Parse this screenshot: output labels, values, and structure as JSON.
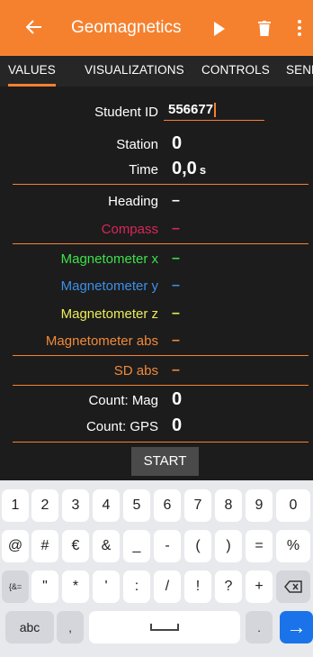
{
  "appbar": {
    "title": "Geomagnetics",
    "icons": [
      "back-arrow-icon",
      "play-icon",
      "trash-icon",
      "more-vert-icon"
    ],
    "color": "#f5812f"
  },
  "tabs": [
    "VALUES",
    "VISUALIZATIONS",
    "CONTROLS",
    "SEND"
  ],
  "active_tab": "VALUES",
  "fields": {
    "student_id": {
      "label": "Student ID",
      "value": "556677"
    },
    "station": {
      "label": "Station",
      "value": "0"
    },
    "time": {
      "label": "Time",
      "value": "0,0",
      "unit": "s"
    },
    "heading": {
      "label": "Heading",
      "value": "–"
    },
    "compass": {
      "label": "Compass",
      "value": "–",
      "color": "#d8265b"
    },
    "mag_x": {
      "label": "Magnetometer x",
      "value": "–",
      "color": "#3de14a"
    },
    "mag_y": {
      "label": "Magnetometer y",
      "value": "–",
      "color": "#3d8fe8"
    },
    "mag_z": {
      "label": "Magnetometer z",
      "value": "–",
      "color": "#ecec5a"
    },
    "mag_abs": {
      "label": "Magnetometer abs",
      "value": "–",
      "color": "#f08a3a"
    },
    "sd_abs": {
      "label": "SD abs",
      "value": "–",
      "color": "#f08a3a"
    },
    "count_mag": {
      "label": "Count: Mag",
      "value": "0"
    },
    "count_gps": {
      "label": "Count: GPS",
      "value": "0"
    }
  },
  "start_button": "START",
  "keyboard": {
    "row1": [
      "1",
      "2",
      "3",
      "4",
      "5",
      "6",
      "7",
      "8",
      "9",
      "0"
    ],
    "row2": [
      "@",
      "#",
      "€",
      "&",
      "_",
      "-",
      "(",
      ")",
      "=",
      "%"
    ],
    "row3": [
      "{&=",
      "\"",
      "*",
      "'",
      ":",
      "/",
      "!",
      "?",
      "+"
    ],
    "row4": [
      "abc",
      ",",
      ".",
      "→"
    ],
    "icons": [
      "backspace-icon",
      "space-bar-icon",
      "enter-arrow-icon"
    ]
  }
}
